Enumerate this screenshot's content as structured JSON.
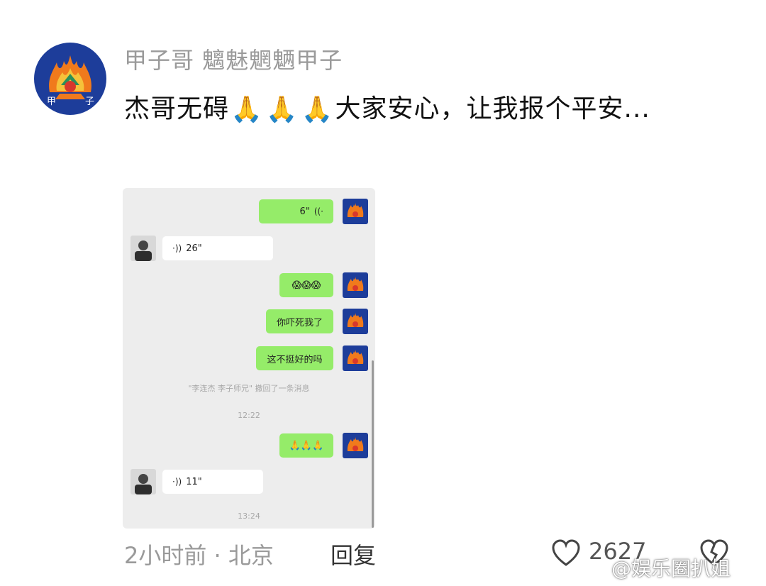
{
  "comment": {
    "username": "甲子哥 魑魅魍魉甲子",
    "avatar_text_left": "甲",
    "avatar_text_right": "子",
    "text_before": "杰哥无碍",
    "emoji": "🙏",
    "text_after": "大家安心，让我报个平安..."
  },
  "chat": {
    "messages": [
      {
        "side": "right",
        "type": "voice",
        "duration": "6\""
      },
      {
        "side": "left",
        "type": "voice",
        "duration": "26\""
      },
      {
        "side": "right",
        "type": "text",
        "text": "😱😱😱"
      },
      {
        "side": "right",
        "type": "text",
        "text": "你吓死我了"
      },
      {
        "side": "right",
        "type": "text",
        "text": "这不挺好的吗"
      }
    ],
    "recall_notice": "\"李连杰 李子师兄\" 撤回了一条消息",
    "time1": "12:22",
    "messages2": [
      {
        "side": "right",
        "type": "text",
        "text": "🙏🙏🙏"
      },
      {
        "side": "left",
        "type": "voice",
        "duration": "11\""
      }
    ],
    "time2": "13:24"
  },
  "footer": {
    "time_location": "2小时前 · 北京",
    "reply_label": "回复",
    "like_count": "2627"
  },
  "watermark": "@娱乐圈扒姐",
  "colors": {
    "green_bubble": "#95ec69",
    "chat_bg": "#ededed",
    "avatar_bg": "#1d3d9a"
  }
}
